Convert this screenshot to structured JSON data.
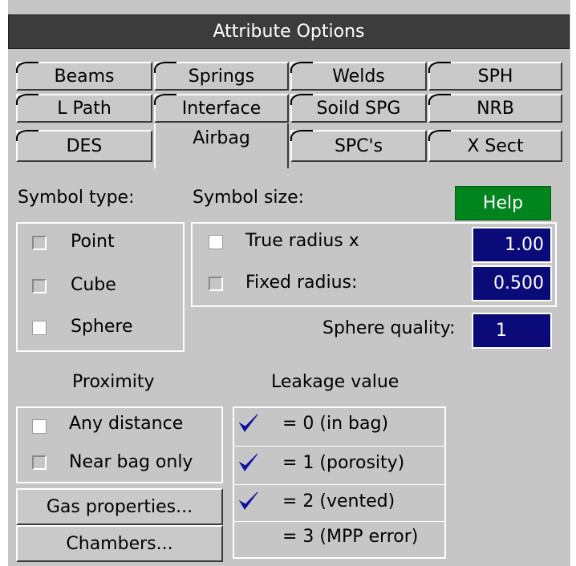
{
  "title": "Attribute Options",
  "tabs": [
    {
      "label": "Beams"
    },
    {
      "label": "Springs"
    },
    {
      "label": "Welds"
    },
    {
      "label": "SPH"
    },
    {
      "label": "L Path"
    },
    {
      "label": "Interface"
    },
    {
      "label": "Soild SPG"
    },
    {
      "label": "NRB"
    },
    {
      "label": "DES"
    },
    {
      "label": "Airbag"
    },
    {
      "label": "SPC's"
    },
    {
      "label": "X Sect"
    }
  ],
  "symbol_type": {
    "label": "Symbol type:",
    "options": [
      {
        "label": "Point",
        "checked": false
      },
      {
        "label": "Cube",
        "checked": false
      },
      {
        "label": "Sphere",
        "checked": true
      }
    ]
  },
  "symbol_size": {
    "label": "Symbol size:",
    "help_label": "Help",
    "true_radius": {
      "label": "True radius x",
      "value": "1.00",
      "checked": true
    },
    "fixed_radius": {
      "label": "Fixed radius:",
      "value": "0.500",
      "checked": false
    },
    "sphere_quality": {
      "label": "Sphere quality:",
      "value": "1"
    }
  },
  "proximity": {
    "label": "Proximity",
    "options": [
      {
        "label": "Any distance",
        "checked": true
      },
      {
        "label": "Near bag only",
        "checked": false
      }
    ]
  },
  "buttons": {
    "gas_properties": "Gas properties...",
    "chambers": "Chambers..."
  },
  "leakage": {
    "label": "Leakage value",
    "items": [
      {
        "label": "= 0 (in bag)",
        "checked": true
      },
      {
        "label": "= 1 (porosity)",
        "checked": true
      },
      {
        "label": "= 2 (vented)",
        "checked": true
      },
      {
        "label": "= 3 (MPP error)",
        "checked": false
      }
    ]
  },
  "colors": {
    "title_bg": "#3c3c3c",
    "panel_bg": "#c6c6c6",
    "field_bg": "#0a0a78",
    "help_bg": "#00841e",
    "check": "#1010a0"
  }
}
